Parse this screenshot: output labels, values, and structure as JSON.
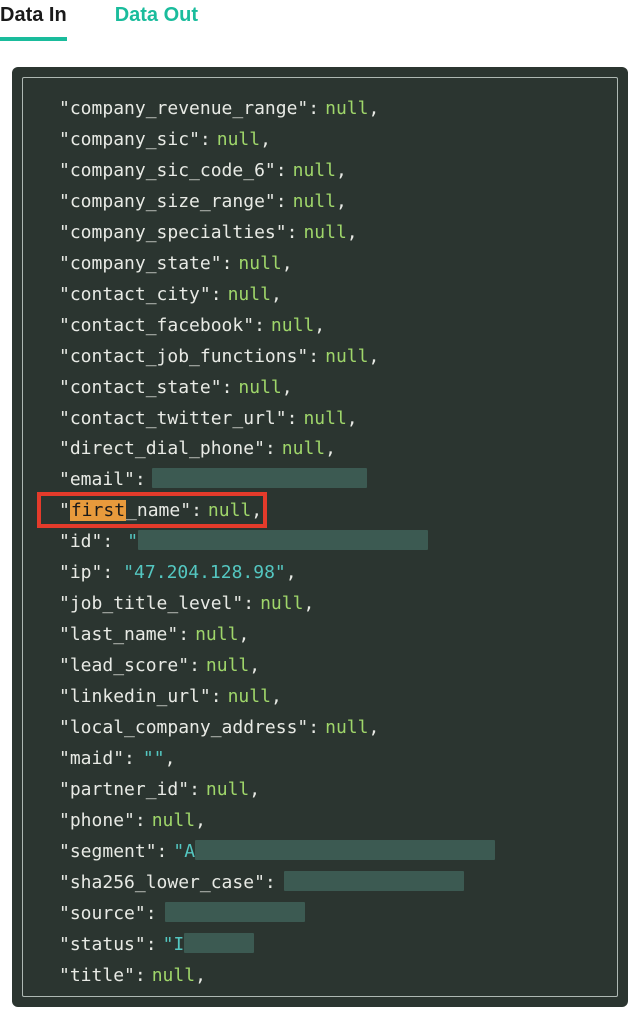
{
  "tabs": {
    "active": "Data In",
    "inactive": "Data Out"
  },
  "json_lines": [
    {
      "key": "company_revenue_range",
      "val_type": "null"
    },
    {
      "key": "company_sic",
      "val_type": "null"
    },
    {
      "key": "company_sic_code_6",
      "val_type": "null"
    },
    {
      "key": "company_size_range",
      "val_type": "null"
    },
    {
      "key": "company_specialties",
      "val_type": "null"
    },
    {
      "key": "company_state",
      "val_type": "null"
    },
    {
      "key": "contact_city",
      "val_type": "null"
    },
    {
      "key": "contact_facebook",
      "val_type": "null"
    },
    {
      "key": "contact_job_functions",
      "val_type": "null"
    },
    {
      "key": "contact_state",
      "val_type": "null"
    },
    {
      "key": "contact_twitter_url",
      "val_type": "null"
    },
    {
      "key": "direct_dial_phone",
      "val_type": "null"
    },
    {
      "key": "email",
      "val_type": "redact_after_colon",
      "redact_w": 215
    },
    {
      "key": "first_name",
      "val_type": "null",
      "highlight_key_prefix": "first",
      "red_box": true
    },
    {
      "key": "id",
      "val_type": "redact_str",
      "redact_w": 290,
      "gap": 14
    },
    {
      "key": "ip",
      "val_type": "str",
      "val": "47.204.128.98",
      "gap": 10
    },
    {
      "key": "job_title_level",
      "val_type": "null"
    },
    {
      "key": "last_name",
      "val_type": "null"
    },
    {
      "key": "lead_score",
      "val_type": "null"
    },
    {
      "key": "linkedin_url",
      "val_type": "null"
    },
    {
      "key": "local_company_address",
      "val_type": "null"
    },
    {
      "key": "maid",
      "val_type": "str",
      "val": "",
      "gap": 8
    },
    {
      "key": "partner_id",
      "val_type": "null"
    },
    {
      "key": "phone",
      "val_type": "null"
    },
    {
      "key": "segment",
      "val_type": "redact_str_partial",
      "prefix": "A",
      "redact_w": 300
    },
    {
      "key": "sha256_lower_case",
      "val_type": "redact_after_colon",
      "redact_w": 180,
      "gap": 8
    },
    {
      "key": "source",
      "val_type": "redact_after_colon",
      "redact_w": 140,
      "gap": 8
    },
    {
      "key": "status",
      "val_type": "redact_str_partial",
      "prefix": "I",
      "redact_w": 70
    },
    {
      "key": "title",
      "val_type": "null"
    }
  ],
  "null_label": "null"
}
